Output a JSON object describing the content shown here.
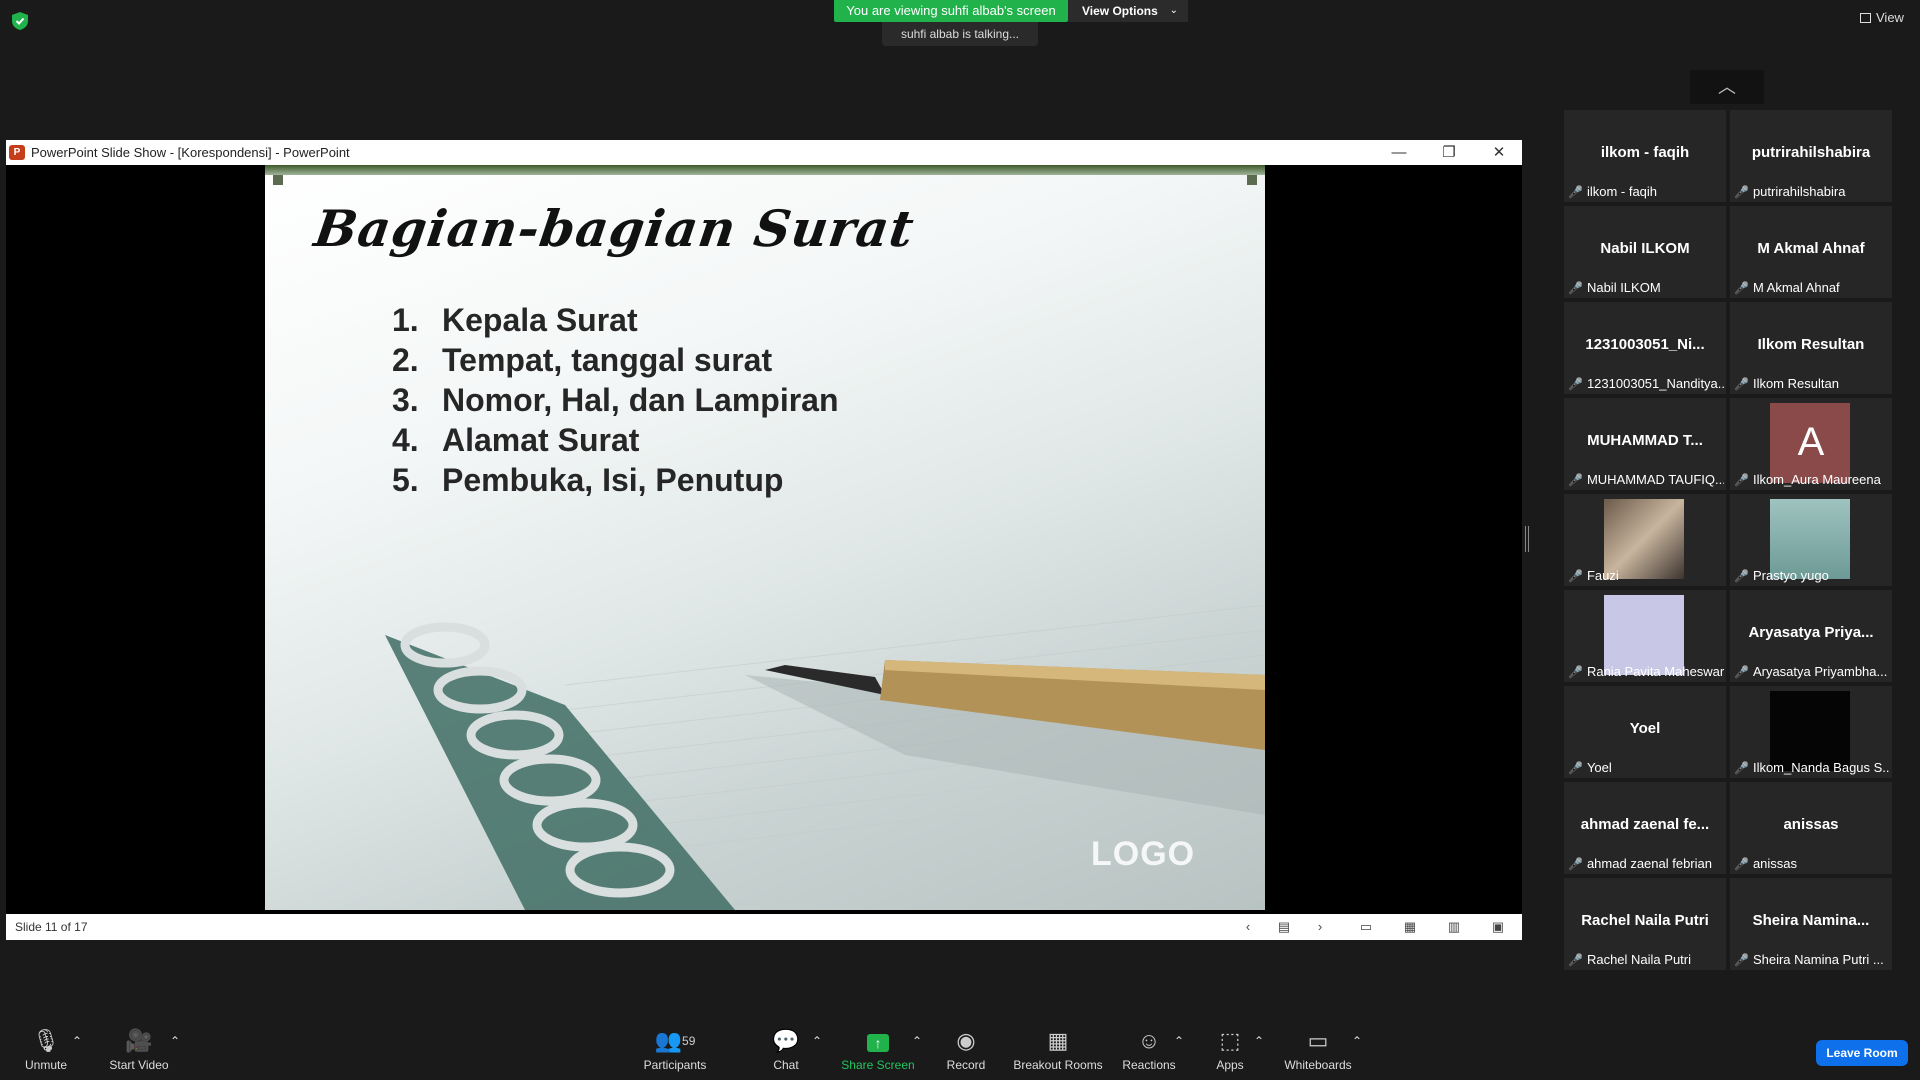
{
  "top": {
    "banner": "You are viewing suhfi albab's screen",
    "view_options": "View Options",
    "talking": "suhfi albab is talking...",
    "view_label": "View"
  },
  "ppt": {
    "window_title": "PowerPoint Slide Show - [Korespondensi] - PowerPoint",
    "slide_title": "Bagian-bagian Surat",
    "items": [
      {
        "num": "1.",
        "text": "Kepala Surat"
      },
      {
        "num": "2.",
        "text": "Tempat, tanggal surat"
      },
      {
        "num": "3.",
        "text": "Nomor, Hal, dan Lampiran"
      },
      {
        "num": "4.",
        "text": "Alamat Surat"
      },
      {
        "num": "5.",
        "text": "Pembuka, Isi, Penutup"
      }
    ],
    "logo": "LOGO",
    "status": "Slide 11 of 17"
  },
  "participants": [
    {
      "big": "ilkom - faqih",
      "label": "ilkom - faqih"
    },
    {
      "big": "putrirahilshabira",
      "label": "putrirahilshabira"
    },
    {
      "big": "Nabil ILKOM",
      "label": "Nabil ILKOM"
    },
    {
      "big": "M Akmal Ahnaf",
      "label": "M Akmal Ahnaf"
    },
    {
      "big": "1231003051_Ni...",
      "label": "1231003051_Nanditya..."
    },
    {
      "big": "Ilkom Resultan",
      "label": "Ilkom Resultan"
    },
    {
      "big": "MUHAMMAD T...",
      "label": "MUHAMMAD TAUFIQ..."
    },
    {
      "big": "A",
      "label": "Ilkom_Aura Maureena"
    },
    {
      "big": "",
      "label": "Fauzi"
    },
    {
      "big": "",
      "label": "Prastyo yugo"
    },
    {
      "big": "",
      "label": "Rania Pavita Maheswari..."
    },
    {
      "big": "Aryasatya Priya...",
      "label": "Aryasatya Priyambha..."
    },
    {
      "big": "Yoel",
      "label": "Yoel"
    },
    {
      "big": "",
      "label": "Ilkom_Nanda Bagus S..."
    },
    {
      "big": "ahmad zaenal fe...",
      "label": "ahmad zaenal febrian"
    },
    {
      "big": "anissas",
      "label": "anissas"
    },
    {
      "big": "Rachel Naila Putri",
      "label": "Rachel Naila Putri"
    },
    {
      "big": "Sheira Namina...",
      "label": "Sheira Namina Putri ..."
    }
  ],
  "toolbar": {
    "unmute": "Unmute",
    "start_video": "Start Video",
    "participants_count": "59",
    "participants": "Participants",
    "chat": "Chat",
    "share_screen": "Share Screen",
    "record": "Record",
    "breakout": "Breakout Rooms",
    "reactions": "Reactions",
    "apps": "Apps",
    "whiteboards": "Whiteboards",
    "leave": "Leave Room"
  },
  "colors": {
    "banner": "#22b24c",
    "leave": "#0e71eb",
    "mic_muted": "#e02828",
    "avatar_a": "#8b4a4a"
  }
}
